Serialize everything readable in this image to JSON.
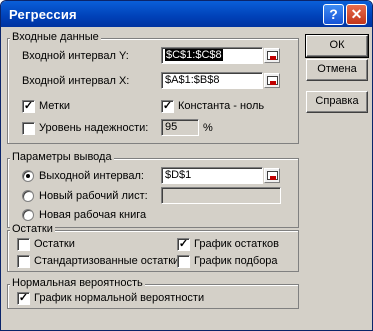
{
  "window": {
    "title": "Регрессия",
    "help_glyph": "?",
    "close_glyph": "✕"
  },
  "input_group": {
    "label": "Входные данные",
    "y_range_label": "Входной интервал Y:",
    "y_range_value": "$C$1:$C$8",
    "x_range_label": "Входной интервал X:",
    "x_range_value": "$A$1:$B$8",
    "labels_checkbox": {
      "label": "Метки",
      "checked": true
    },
    "constant_zero_checkbox": {
      "label": "Константа - ноль",
      "checked": true
    },
    "confidence_checkbox": {
      "label": "Уровень надежности:",
      "checked": false
    },
    "confidence_value": "95",
    "confidence_unit": "%"
  },
  "output_group": {
    "label": "Параметры вывода",
    "output_range_radio": {
      "label": "Выходной интервал:",
      "selected": true
    },
    "output_range_value": "$D$1",
    "new_sheet_radio": {
      "label": "Новый рабочий лист:",
      "selected": false
    },
    "new_sheet_value": "",
    "new_book_radio": {
      "label": "Новая рабочая книга",
      "selected": false
    }
  },
  "residuals_group": {
    "label": "Остатки",
    "residuals": {
      "label": "Остатки",
      "checked": false
    },
    "standardized_residuals": {
      "label": "Стандартизованные остатки",
      "checked": false
    },
    "residual_plots": {
      "label": "График остатков",
      "checked": true
    },
    "line_fit_plots": {
      "label": "График подбора",
      "checked": false
    }
  },
  "normal_group": {
    "label": "Нормальная вероятность",
    "normal_plot": {
      "label": "График нормальной вероятности",
      "checked": true
    }
  },
  "buttons": {
    "ok": "ОК",
    "cancel": "Отмена",
    "help": "Справка"
  }
}
